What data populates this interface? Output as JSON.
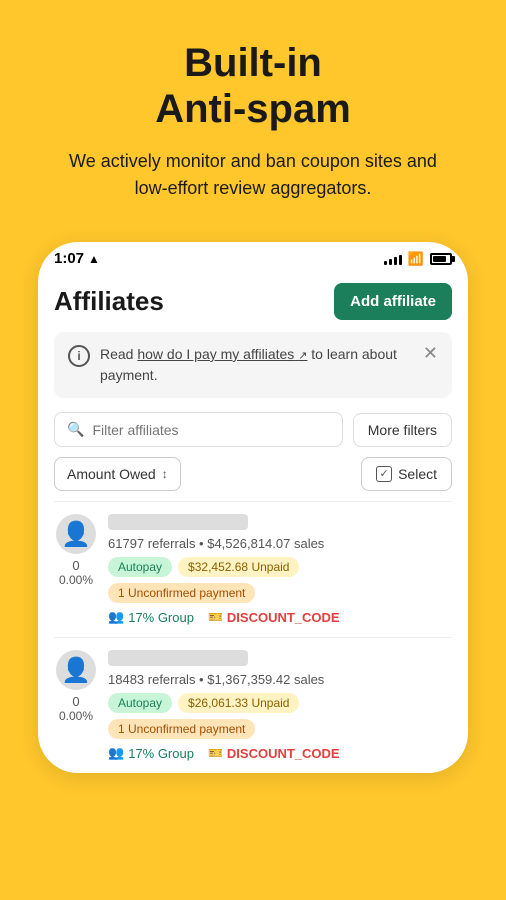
{
  "hero": {
    "title": "Built-in\nAnti-spam",
    "subtitle": "We actively monitor and ban coupon sites and low-effort review aggregators."
  },
  "status_bar": {
    "time": "1:07",
    "signal_label": "signal",
    "wifi_label": "wifi",
    "battery_label": "battery"
  },
  "app": {
    "title": "Affiliates",
    "add_button": "Add affiliate"
  },
  "info_banner": {
    "text_prefix": "Read ",
    "link_text": "how do I pay my affiliates",
    "text_suffix": " to learn about payment."
  },
  "filters": {
    "search_placeholder": "Filter affiliates",
    "more_filters_label": "More filters"
  },
  "sort_row": {
    "amount_owed_label": "Amount Owed",
    "select_label": "Select"
  },
  "affiliates": [
    {
      "id": 1,
      "score": "0",
      "score_pct": "0.00%",
      "stats": "61797 referrals • $4,526,814.07 sales",
      "badges": [
        {
          "text": "Autopay",
          "type": "green"
        },
        {
          "text": "$32,452.68 Unpaid",
          "type": "yellow"
        },
        {
          "text": "1 Unconfirmed payment",
          "type": "orange"
        }
      ],
      "group": "17% Group",
      "discount": "DISCOUNT_CODE"
    },
    {
      "id": 2,
      "score": "0",
      "score_pct": "0.00%",
      "stats": "18483 referrals • $1,367,359.42 sales",
      "badges": [
        {
          "text": "Autopay",
          "type": "green"
        },
        {
          "text": "$26,061.33 Unpaid",
          "type": "yellow"
        },
        {
          "text": "1 Unconfirmed payment",
          "type": "orange"
        }
      ],
      "group": "17% Group",
      "discount": "DISCOUNT_CODE"
    }
  ]
}
